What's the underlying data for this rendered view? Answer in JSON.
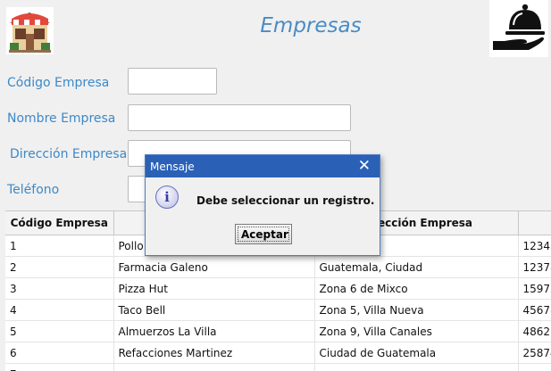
{
  "form": {
    "title": "Empresas",
    "codigo_label": "Código Empresa",
    "nombre_label": "Nombre Empresa",
    "direccion_label": "Dirección Empresa",
    "telefono_label": "Teléfono",
    "codigo_value": "",
    "nombre_value": "",
    "direccion_value": "",
    "telefono_value": ""
  },
  "table": {
    "headers": [
      "Código Empresa",
      "",
      "Dirección Empresa",
      "T"
    ],
    "rows": [
      {
        "codigo": "1",
        "nombre": "Pollo",
        "direccion": "iudad",
        "telefono": "12345"
      },
      {
        "codigo": "2",
        "nombre": "Farmacia Galeno",
        "direccion": "Guatemala, Ciudad",
        "telefono": "12378"
      },
      {
        "codigo": "3",
        "nombre": "Pizza Hut",
        "direccion": "Zona 6 de Mixco",
        "telefono": "15975"
      },
      {
        "codigo": "4",
        "nombre": "Taco Bell",
        "direccion": "Zona 5, Villa Nueva",
        "telefono": "45678"
      },
      {
        "codigo": "5",
        "nombre": "Almuerzos La Villa",
        "direccion": "Zona 9, Villa Canales",
        "telefono": "48621"
      },
      {
        "codigo": "6",
        "nombre": "Refacciones Martinez",
        "direccion": "Ciudad de Guatemala",
        "telefono": "25874"
      },
      {
        "codigo": "7",
        "nombre": "",
        "direccion": "",
        "telefono": ""
      }
    ]
  },
  "dialog": {
    "title": "Mensaje",
    "close_glyph": "✕",
    "message": "Debe seleccionar un registro.",
    "ok_label": "Aceptar",
    "icon_glyph": "i"
  },
  "icons": {
    "left_logo": "restaurant-storefront-icon",
    "right_logo": "serving-cloche-hand-icon"
  },
  "colors": {
    "accent": "#3d89c7",
    "titlebar": "#2a61b6"
  }
}
